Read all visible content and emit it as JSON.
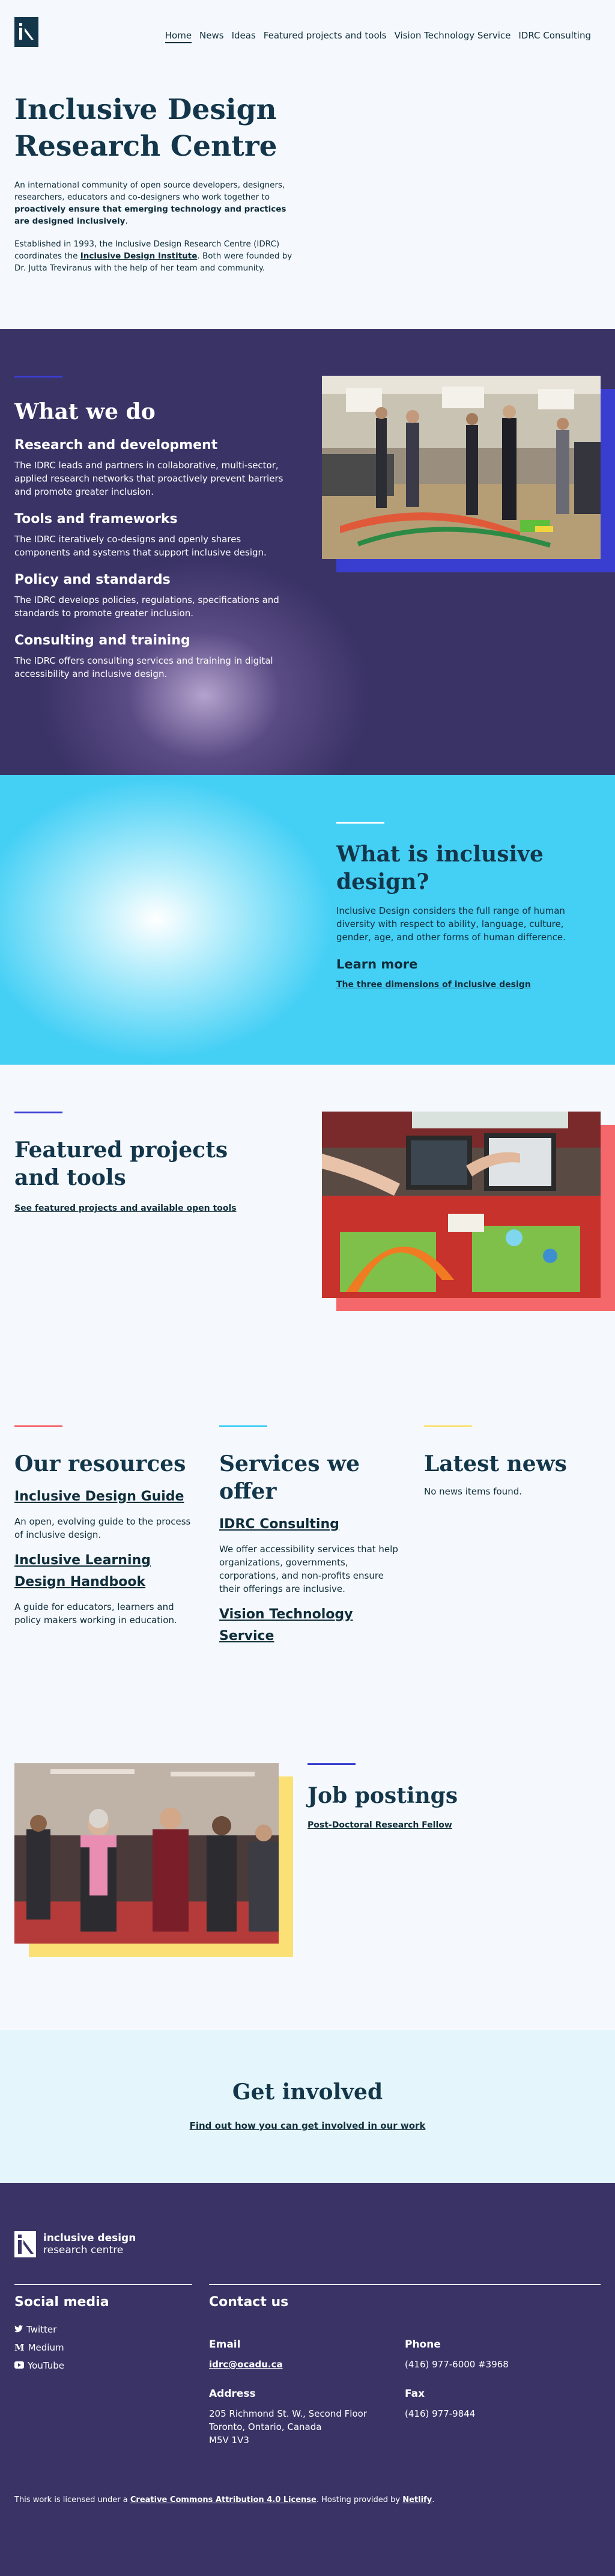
{
  "nav": {
    "items": [
      "Home",
      "News",
      "Ideas",
      "Featured projects and tools",
      "Vision Technology Service",
      "IDRC Consulting"
    ]
  },
  "hero": {
    "title": "Inclusive Design Research Centre",
    "intro_plain": "An international community of open source developers, designers, researchers, educators and co-designers who work together to ",
    "intro_bold": "proactively ensure that emerging technology and practices are designed inclusively",
    "intro_end": ".",
    "history_start": "Established in 1993, the Inclusive Design Research Centre (IDRC) coordinates the ",
    "history_link": "Inclusive Design Institute",
    "history_end": ". Both were founded by Dr. Jutta Treviranus with the help of her team and community."
  },
  "what_we_do": {
    "title": "What we do",
    "items": [
      {
        "heading": "Research and development",
        "text": "The IDRC leads and partners in collaborative, multi-sector, applied research networks that proactively prevent barriers and promote greater inclusion."
      },
      {
        "heading": "Tools and frameworks",
        "text": "The IDRC iteratively co-designs and openly shares components and systems that support inclusive design."
      },
      {
        "heading": "Policy and standards",
        "text": "The IDRC develops policies, regulations, specifications and standards to promote greater inclusion."
      },
      {
        "heading": "Consulting and training",
        "text": "The IDRC offers consulting services and training in digital accessibility and inclusive design."
      }
    ]
  },
  "inclusive": {
    "title": "What is inclusive design?",
    "text": "Inclusive Design considers the full range of human diversity with respect to ability, language, culture, gender, age, and other forms of human difference.",
    "learn_more": "Learn more",
    "link": "The three dimensions of inclusive design"
  },
  "featured": {
    "title": "Featured projects and tools",
    "link": "See featured projects and available open tools"
  },
  "resources": {
    "title": "Our resources",
    "items": [
      {
        "link": "Inclusive Design Guide",
        "text": "An open, evolving guide to the process of inclusive design."
      },
      {
        "link": "Inclusive Learning Design Handbook",
        "text": "A guide for educators, learners and policy makers working in education."
      }
    ]
  },
  "services": {
    "title": "Services we offer",
    "items": [
      {
        "link": "IDRC Consulting",
        "text": "We offer accessibility services that help organizations, governments, corporations, and non-profits ensure their offerings are inclusive."
      },
      {
        "link": "Vision Technology Service",
        "text": ""
      }
    ]
  },
  "news": {
    "title": "Latest news",
    "empty": "No news items found."
  },
  "jobs": {
    "title": "Job postings",
    "link": "Post-Doctoral Research Fellow"
  },
  "involved": {
    "title": "Get involved",
    "link": "Find out how you can get involved in our work"
  },
  "footer": {
    "logo_line1": "inclusive design",
    "logo_line2": "research centre",
    "social_title": "Social media",
    "social": [
      {
        "icon": "twitter-icon",
        "label": "Twitter"
      },
      {
        "icon": "medium-icon",
        "label": "Medium"
      },
      {
        "icon": "youtube-icon",
        "label": "YouTube"
      }
    ],
    "contact_title": "Contact us",
    "email_label": "Email",
    "email": "idrc@ocadu.ca",
    "phone_label": "Phone",
    "phone": "(416) 977-6000 #3968",
    "address_label": "Address",
    "address_line1": "205 Richmond St. W., Second Floor",
    "address_line2": "Toronto, Ontario, Canada",
    "address_line3": "M5V 1V3",
    "fax_label": "Fax",
    "fax": "(416) 977-9844",
    "license_start": "This work is licensed under a ",
    "license_link": "Creative Commons Attribution 4.0 License",
    "license_mid": ". Hosting provided by ",
    "host_link": "Netlify",
    "license_end": "."
  },
  "colors": {
    "purple": "#3a3366",
    "blue_accent": "#3a3ed0",
    "cyan": "#44cff5",
    "coral": "#f4686b",
    "yellow": "#fbe075",
    "navy_text": "#13364a"
  }
}
